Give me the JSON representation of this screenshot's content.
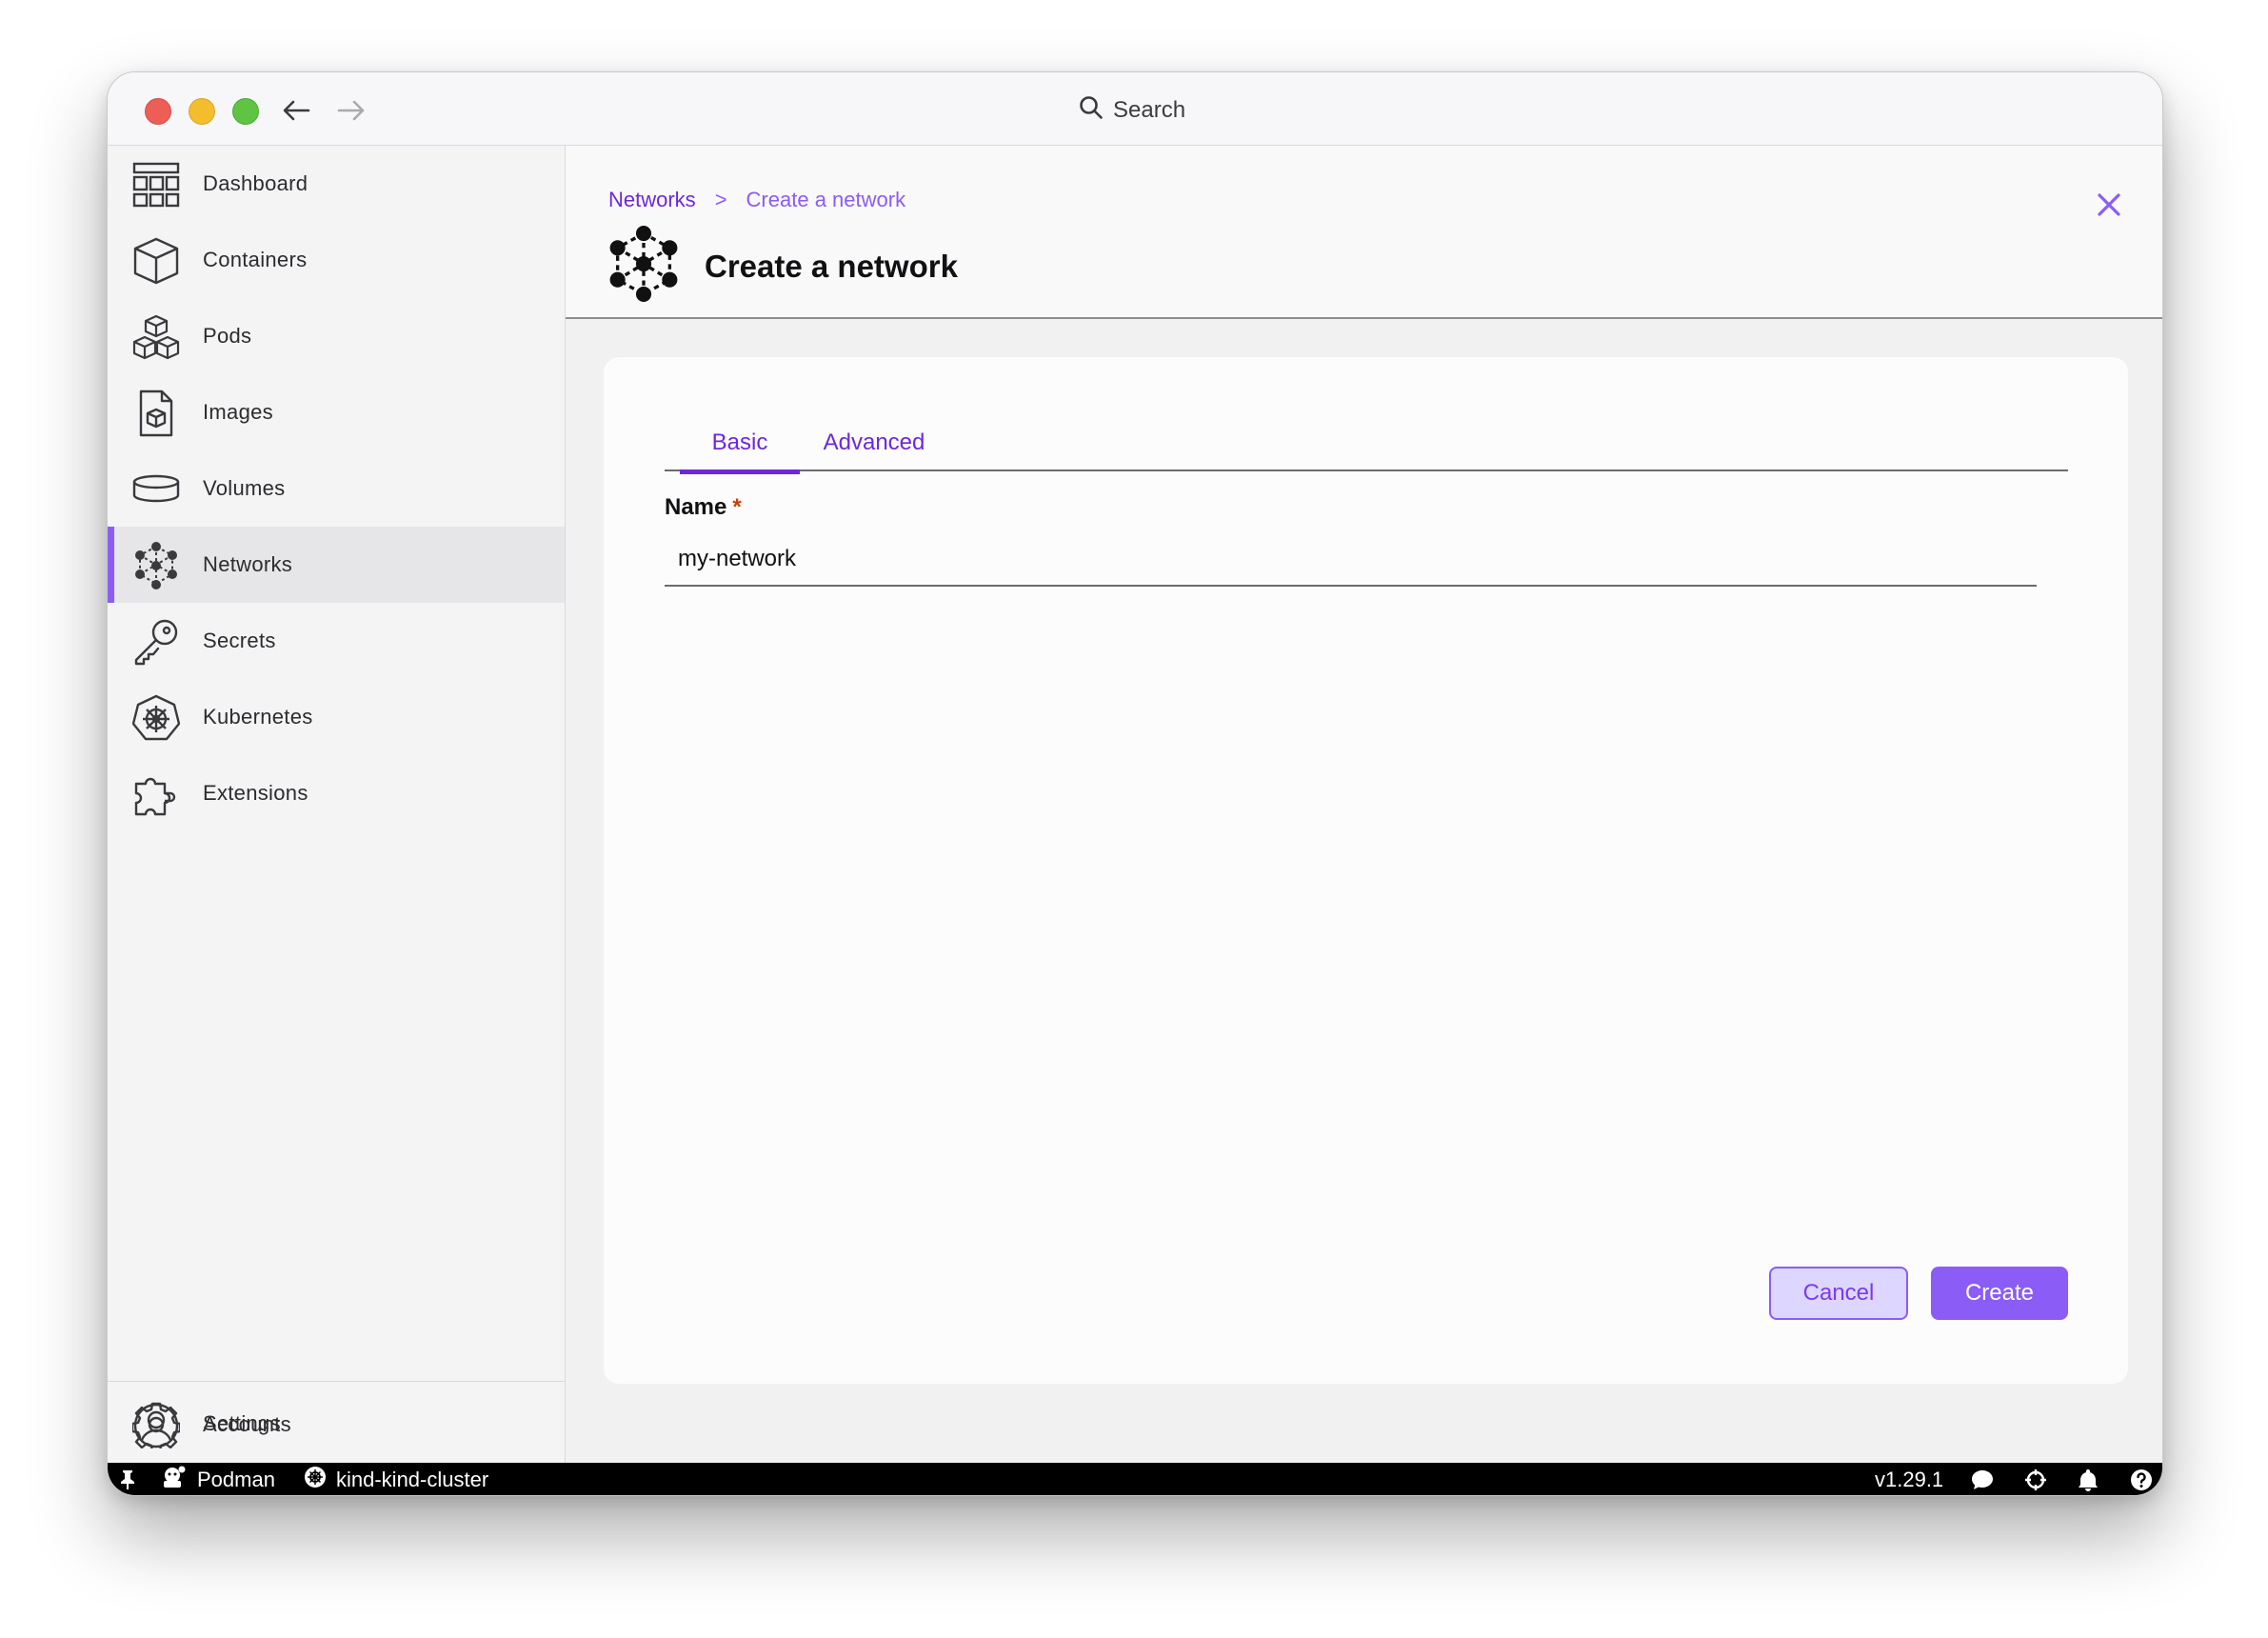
{
  "titlebar": {
    "search_label": "Search"
  },
  "sidebar": {
    "items": [
      {
        "label": "Dashboard",
        "icon": "dashboard-icon"
      },
      {
        "label": "Containers",
        "icon": "container-icon"
      },
      {
        "label": "Pods",
        "icon": "pods-icon"
      },
      {
        "label": "Images",
        "icon": "image-icon"
      },
      {
        "label": "Volumes",
        "icon": "volume-icon"
      },
      {
        "label": "Networks",
        "icon": "network-icon",
        "active": true
      },
      {
        "label": "Secrets",
        "icon": "key-icon"
      },
      {
        "label": "Kubernetes",
        "icon": "kubernetes-icon"
      },
      {
        "label": "Extensions",
        "icon": "puzzle-icon"
      }
    ],
    "bottom_items": [
      {
        "label": "Accounts",
        "icon": "account-icon"
      },
      {
        "label": "Settings",
        "icon": "gear-icon"
      }
    ]
  },
  "header": {
    "breadcrumb": {
      "parent": "Networks",
      "separator": ">",
      "current": "Create a network"
    },
    "title": "Create a network"
  },
  "form": {
    "tabs": [
      {
        "label": "Basic",
        "active": true
      },
      {
        "label": "Advanced"
      }
    ],
    "name_label": "Name",
    "required_marker": "*",
    "name_value": "my-network",
    "cancel_label": "Cancel",
    "create_label": "Create"
  },
  "statusbar": {
    "engine": "Podman",
    "context": "kind-kind-cluster",
    "version": "v1.29.1"
  },
  "colors": {
    "accent": "#8b5cf6",
    "accent_dark": "#6d28d9",
    "statusbar": "#000000"
  }
}
